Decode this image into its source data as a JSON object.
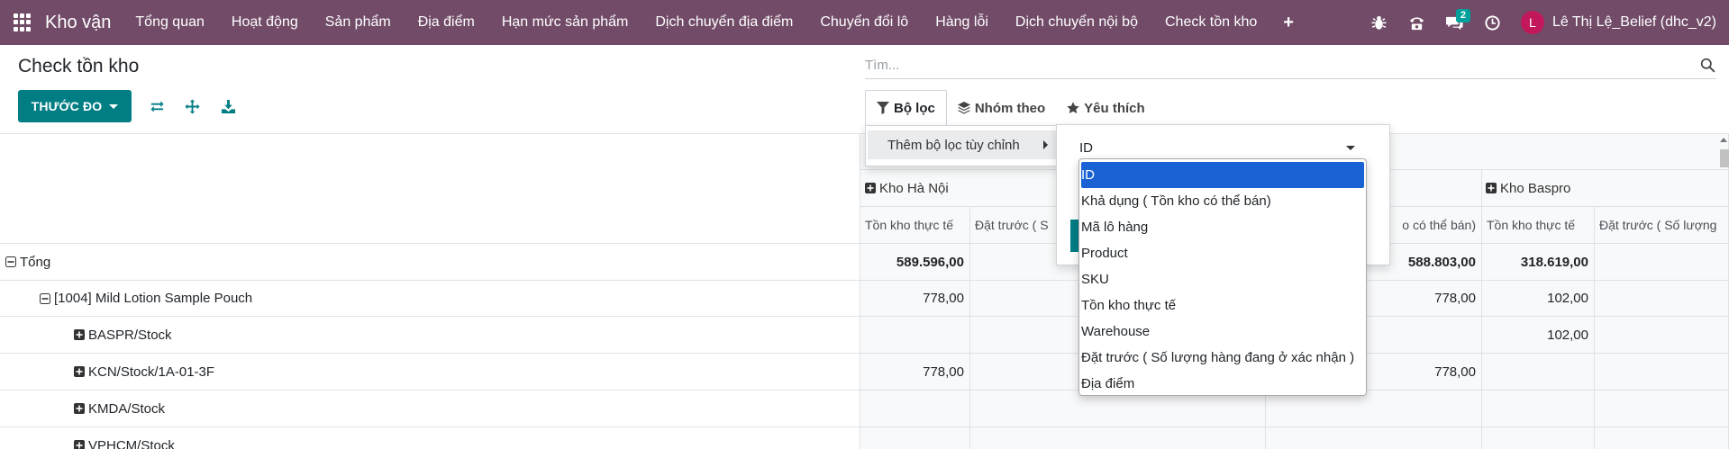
{
  "navbar": {
    "brand": "Kho vận",
    "menu": [
      "Tổng quan",
      "Hoạt động",
      "Sản phẩm",
      "Địa điểm",
      "Hạn mức sản phẩm",
      "Dịch chuyển địa điểm",
      "Chuyển đổi lô",
      "Hàng lỗi",
      "Dịch chuyển nội bộ",
      "Check tồn kho"
    ],
    "plus": "+",
    "chat_badge": "2",
    "user_initial": "L",
    "user_name": "Lê Thị Lệ_Belief (dhc_v2)"
  },
  "control_panel": {
    "title": "Check tồn kho",
    "measures_label": "THƯỚC ĐO",
    "search_placeholder": "Tìm...",
    "tabs": {
      "filter": "Bộ lọc",
      "group_by": "Nhóm theo",
      "favorites": "Yêu thích"
    }
  },
  "filter_menu": {
    "add_custom_filter": "Thêm bộ lọc tùy chỉnh",
    "field_select_value": "ID",
    "field_options": [
      "ID",
      "Khả dụng ( Tồn kho có thể bán)",
      "Mã lô hàng",
      "Product",
      "SKU",
      "Tồn kho thực tế",
      "Warehouse",
      "Đặt trước ( Số lượng hàng đang ở xác nhận )",
      "Địa điểm"
    ]
  },
  "pivot": {
    "col_groups": [
      "Kho Hà Nội",
      "Kho Baspro"
    ],
    "measures": {
      "m1": "Tồn kho thực tế",
      "m2_partial": "Đặt trước ( S",
      "m3_partial": "o có thể bán)",
      "m4": "Tồn kho thực tế",
      "m5_partial": "Đặt trước ( Số lượng"
    },
    "rows": [
      {
        "label": "Tổng",
        "c1": "589.596,00",
        "c3": "588.803,00",
        "c4": "318.619,00"
      },
      {
        "label": "[1004] Mild Lotion Sample Pouch",
        "c1": "778,00",
        "c3": "778,00",
        "c4": "102,00"
      },
      {
        "label": "BASPR/Stock",
        "c1": "",
        "c3": "",
        "c4": "102,00"
      },
      {
        "label": "KCN/Stock/1A-01-3F",
        "c1": "778,00",
        "c3": "778,00",
        "c4": ""
      },
      {
        "label": "KMDA/Stock",
        "c1": "",
        "c3": "",
        "c4": ""
      },
      {
        "label": "VPHCM/Stock",
        "c1": "",
        "c3": "",
        "c4": ""
      }
    ]
  },
  "colors": {
    "navbar": "#714b67",
    "primary": "#017e84",
    "option_highlight": "#1a62d3"
  }
}
